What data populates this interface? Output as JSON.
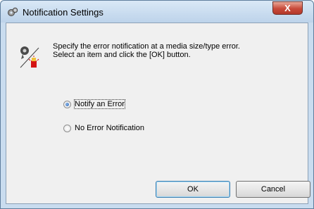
{
  "window": {
    "title": "Notification Settings",
    "close_glyph": "X"
  },
  "message": {
    "line1": "Specify the error notification at a media size/type error.",
    "line2": "Select an item and click the [OK] button."
  },
  "options": [
    {
      "label": "Notify an Error",
      "selected": true
    },
    {
      "label": "No Error Notification",
      "selected": false
    }
  ],
  "buttons": {
    "ok": "OK",
    "cancel": "Cancel"
  },
  "icons": {
    "title": "gears-icon",
    "message": "notification-error-icon"
  },
  "colors": {
    "close": "#c8493a",
    "frame": "#c9dcef",
    "client": "#f0f0f0",
    "radio_selected": "#1f5fb5"
  }
}
